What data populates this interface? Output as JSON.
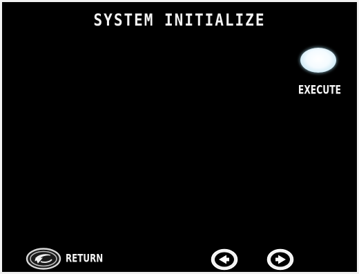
{
  "screen": {
    "title": "SYSTEM INITIALIZE"
  },
  "actions": {
    "execute_label": "EXECUTE",
    "return_label": "RETURN"
  },
  "icons": {
    "execute": "oval-button-icon",
    "return": "return-icon",
    "prev": "left-arrow-icon",
    "next": "right-arrow-icon"
  },
  "colors": {
    "background": "#000000",
    "border": "#f2f2f2",
    "text": "#f4f4f4",
    "execute_button": "#e6f6fd"
  }
}
